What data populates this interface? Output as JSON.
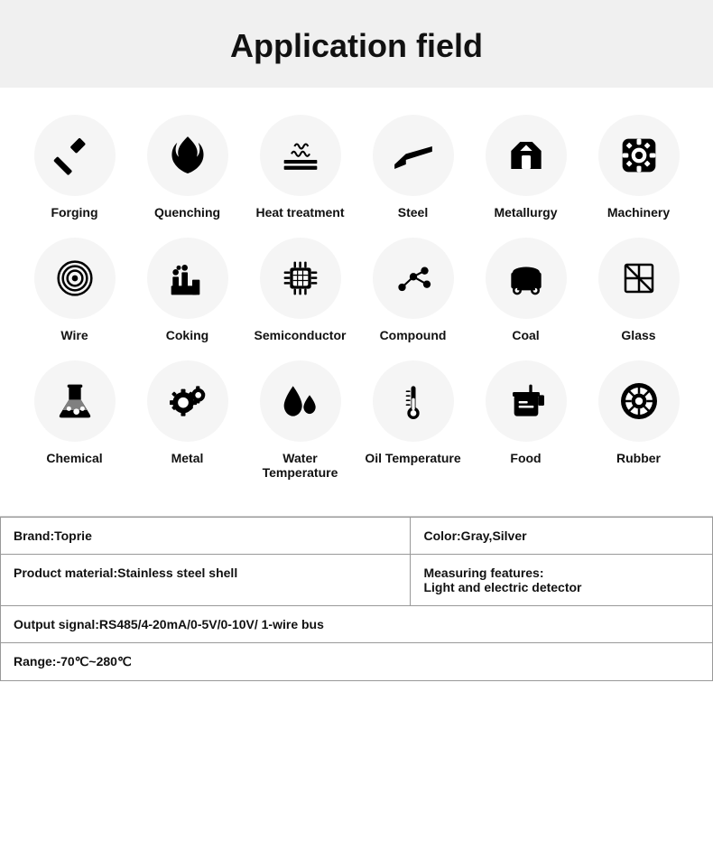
{
  "header": {
    "title": "Application field"
  },
  "rows": [
    [
      {
        "label": "Forging",
        "icon": "forging"
      },
      {
        "label": "Quenching",
        "icon": "quenching"
      },
      {
        "label": "Heat treatment",
        "icon": "heat-treatment"
      },
      {
        "label": "Steel",
        "icon": "steel"
      },
      {
        "label": "Metallurgy",
        "icon": "metallurgy"
      },
      {
        "label": "Machinery",
        "icon": "machinery"
      }
    ],
    [
      {
        "label": "Wire",
        "icon": "wire"
      },
      {
        "label": "Coking",
        "icon": "coking"
      },
      {
        "label": "Semiconductor",
        "icon": "semiconductor"
      },
      {
        "label": "Compound",
        "icon": "compound"
      },
      {
        "label": "Coal",
        "icon": "coal"
      },
      {
        "label": "Glass",
        "icon": "glass"
      }
    ],
    [
      {
        "label": "Chemical",
        "icon": "chemical"
      },
      {
        "label": "Metal",
        "icon": "metal"
      },
      {
        "label": "Water Temperature",
        "icon": "water-temperature"
      },
      {
        "label": "Oil Temperature",
        "icon": "oil-temperature"
      },
      {
        "label": "Food",
        "icon": "food"
      },
      {
        "label": "Rubber",
        "icon": "rubber"
      }
    ]
  ],
  "specs": {
    "brand_label": "Brand:Toprie",
    "color_label": "Color:Gray,Silver",
    "material_label": "Product material:Stainless steel shell",
    "measuring_label": "Measuring features:",
    "measuring_value": "Light and electric detector",
    "output_label": "Output signal:RS485/4-20mA/0-5V/0-10V/ 1-wire bus",
    "range_label": "Range:-70℃~280℃"
  }
}
